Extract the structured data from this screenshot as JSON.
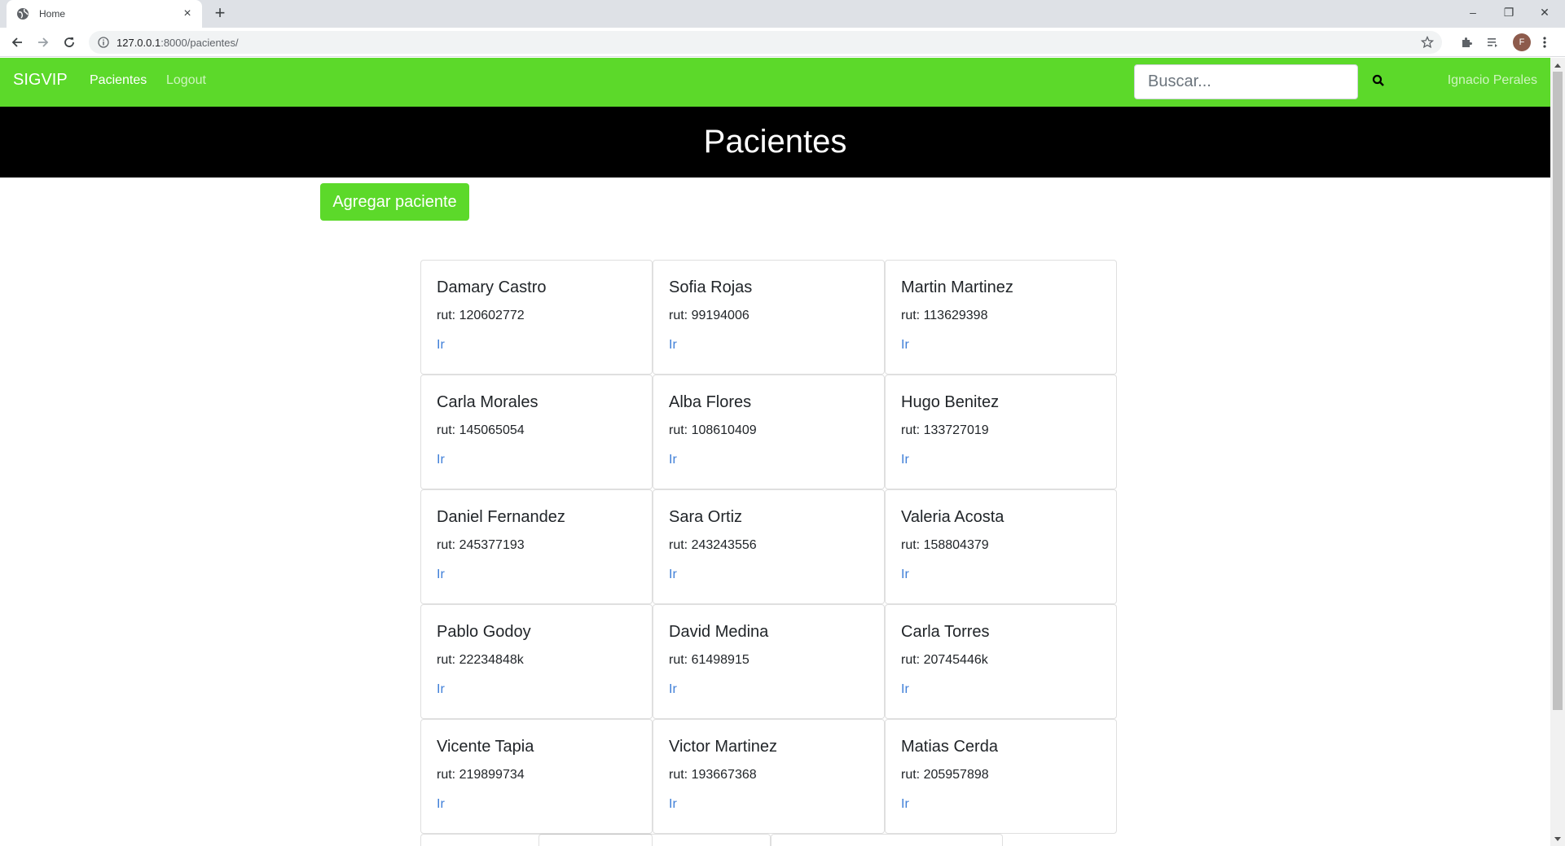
{
  "browser": {
    "tab_title": "Home",
    "tab_close": "×",
    "new_tab": "+",
    "url_host": "127.0.0.1",
    "url_rest": ":8000/pacientes/",
    "profile_initial": "F",
    "window_controls": {
      "minimize": "–",
      "restore": "❐",
      "close": "✕"
    }
  },
  "navbar": {
    "brand": "SIGVIP",
    "links": [
      {
        "label": "Pacientes",
        "active": true
      },
      {
        "label": "Logout",
        "active": false
      }
    ],
    "search_placeholder": "Buscar...",
    "user": "Ignacio Perales",
    "accent_color": "#5cd92a"
  },
  "hero": {
    "title": "Pacientes"
  },
  "actions": {
    "add_patient": "Agregar paciente"
  },
  "patients": [
    {
      "name": "Damary Castro",
      "rut": "rut: 120602772",
      "link": "Ir"
    },
    {
      "name": "Sofia Rojas",
      "rut": "rut: 99194006",
      "link": "Ir"
    },
    {
      "name": "Martin Martinez",
      "rut": "rut: 113629398",
      "link": "Ir"
    },
    {
      "name": "Carla Morales",
      "rut": "rut: 145065054",
      "link": "Ir"
    },
    {
      "name": "Alba Flores",
      "rut": "rut: 108610409",
      "link": "Ir"
    },
    {
      "name": "Hugo Benitez",
      "rut": "rut: 133727019",
      "link": "Ir"
    },
    {
      "name": "Daniel Fernandez",
      "rut": "rut: 245377193",
      "link": "Ir"
    },
    {
      "name": "Sara Ortiz",
      "rut": "rut: 243243556",
      "link": "Ir"
    },
    {
      "name": "Valeria Acosta",
      "rut": "rut: 158804379",
      "link": "Ir"
    },
    {
      "name": "Pablo Godoy",
      "rut": "rut: 22234848k",
      "link": "Ir"
    },
    {
      "name": "David Medina",
      "rut": "rut: 61498915",
      "link": "Ir"
    },
    {
      "name": "Carla Torres",
      "rut": "rut: 20745446k",
      "link": "Ir"
    },
    {
      "name": "Vicente Tapia",
      "rut": "rut: 219899734",
      "link": "Ir"
    },
    {
      "name": "Victor Martinez",
      "rut": "rut: 193667368",
      "link": "Ir"
    },
    {
      "name": "Matias Cerda",
      "rut": "rut: 205957898",
      "link": "Ir"
    }
  ]
}
